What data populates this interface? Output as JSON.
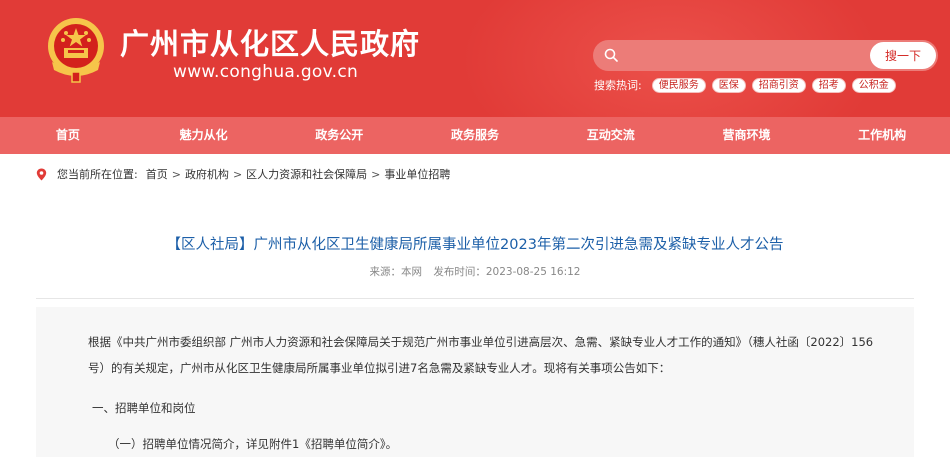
{
  "header": {
    "site_title": "广州市从化区人民政府",
    "site_url": "www.conghua.gov.cn",
    "search_placeholder": "",
    "search_button": "搜一下",
    "hot_label": "搜索热词:",
    "hot_tags": [
      "便民服务",
      "医保",
      "招商引资",
      "招考",
      "公积金"
    ]
  },
  "nav": {
    "items": [
      "首页",
      "魅力从化",
      "政务公开",
      "政务服务",
      "互动交流",
      "营商环境",
      "工作机构"
    ]
  },
  "breadcrumb": {
    "prefix": "您当前所在位置:",
    "items": [
      "首页",
      "政府机构",
      "区人力资源和社会保障局",
      "事业单位招聘"
    ]
  },
  "article": {
    "title": "【区人社局】广州市从化区卫生健康局所属事业单位2023年第二次引进急需及紧缺专业人才公告",
    "source": "来源：本网",
    "published": "发布时间：2023-08-25 16:12",
    "paragraphs": [
      "根据《中共广州市委组织部 广州市人力资源和社会保障局关于规范广州市事业单位引进高层次、急需、紧缺专业人才工作的通知》（穗人社函〔2022〕156号）的有关规定，广州市从化区卫生健康局所属事业单位拟引进7名急需及紧缺专业人才。现将有关事项公告如下：",
      "一、招聘单位和岗位",
      "（一）招聘单位情况简介，详见附件1《招聘单位简介》。"
    ]
  },
  "colors": {
    "header_red": "#e13b37",
    "nav_red": "#ec6462",
    "title_blue": "#1c5fa8"
  }
}
